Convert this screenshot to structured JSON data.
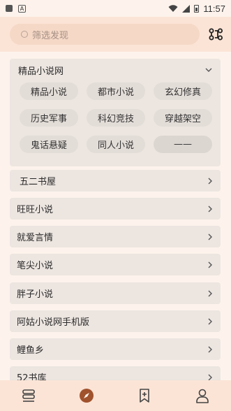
{
  "status": {
    "time": "11:57"
  },
  "search": {
    "placeholder": "筛选发现"
  },
  "group": {
    "title": "精品小说网"
  },
  "chips": [
    {
      "label": "精品小说"
    },
    {
      "label": "都市小说"
    },
    {
      "label": "玄幻修真"
    },
    {
      "label": "历史军事"
    },
    {
      "label": "科幻竞技"
    },
    {
      "label": "穿越架空"
    },
    {
      "label": "鬼话悬疑"
    },
    {
      "label": "同人小说"
    },
    {
      "label": "——"
    }
  ],
  "sources": [
    {
      "label": "五二书屋"
    },
    {
      "label": "旺旺小说"
    },
    {
      "label": "就爱言情"
    },
    {
      "label": "笔尖小说"
    },
    {
      "label": "胖子小说"
    },
    {
      "label": "阿姑小说网手机版"
    },
    {
      "label": "鲤鱼乡"
    },
    {
      "label": "52书库"
    }
  ],
  "colors": {
    "accent": "#a0522d",
    "header_bg": "#fbe4d6",
    "card_bg": "#ece5e0"
  }
}
